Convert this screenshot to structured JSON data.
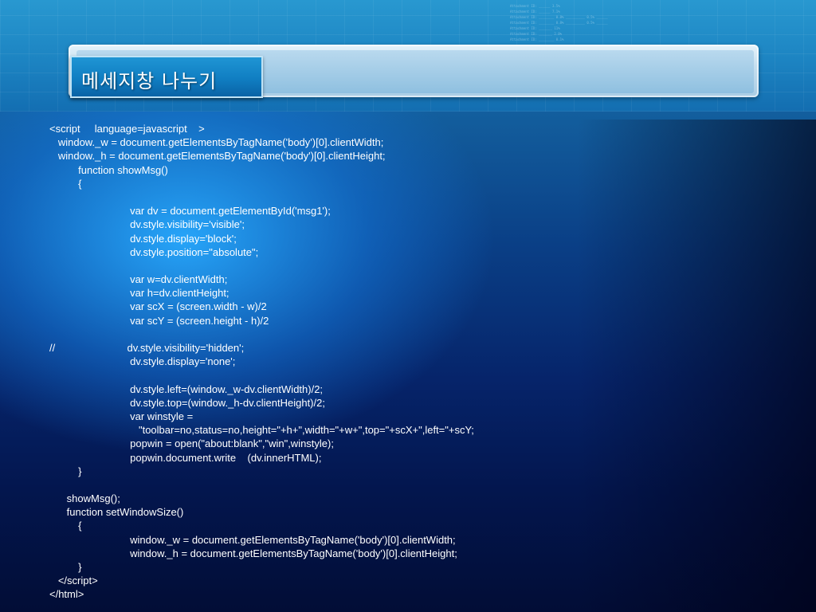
{
  "title": "메세지창 나누기",
  "background_tiny_text": [
    "Attachment ID: ______ 3.5%",
    "Attachment ID: ______ 7.1%",
    "Attachment ID: ________ 0.8% __________ 0.5% ______",
    "Attachment ID: ________ 0.8% __________ 0.5% ______",
    "Attachment ID: _______ 11%",
    "Attachment ID: _______ 2.0%",
    "Attachment ID: ________ 0.1%"
  ],
  "code_lines": [
    "<script     language=javascript    >",
    "   window._w = document.getElementsByTagName('body')[0].clientWidth;",
    "   window._h = document.getElementsByTagName('body')[0].clientHeight;",
    "          function showMsg()",
    "          {",
    "",
    "                            var dv = document.getElementById('msg1');",
    "                            dv.style.visibility='visible';",
    "                            dv.style.display='block';",
    "                            dv.style.position=\"absolute\";",
    "",
    "                            var w=dv.clientWidth;",
    "                            var h=dv.clientHeight;",
    "                            var scX = (screen.width - w)/2",
    "                            var scY = (screen.height - h)/2",
    "",
    "//                         dv.style.visibility='hidden';",
    "                            dv.style.display='none';",
    "",
    "                            dv.style.left=(window._w-dv.clientWidth)/2;",
    "                            dv.style.top=(window._h-dv.clientHeight)/2;",
    "                            var winstyle =",
    "                               \"toolbar=no,status=no,height=\"+h+\",width=\"+w+\",top=\"+scX+\",left=\"+scY;",
    "                            popwin = open(\"about:blank\",\"win\",winstyle);",
    "                            popwin.document.write    (dv.innerHTML);",
    "          }",
    "",
    "      showMsg();",
    "      function setWindowSize()",
    "          {",
    "                            window._w = document.getElementsByTagName('body')[0].clientWidth;",
    "                            window._h = document.getElementsByTagName('body')[0].clientHeight;",
    "          }",
    "   </script>",
    "</html>"
  ]
}
